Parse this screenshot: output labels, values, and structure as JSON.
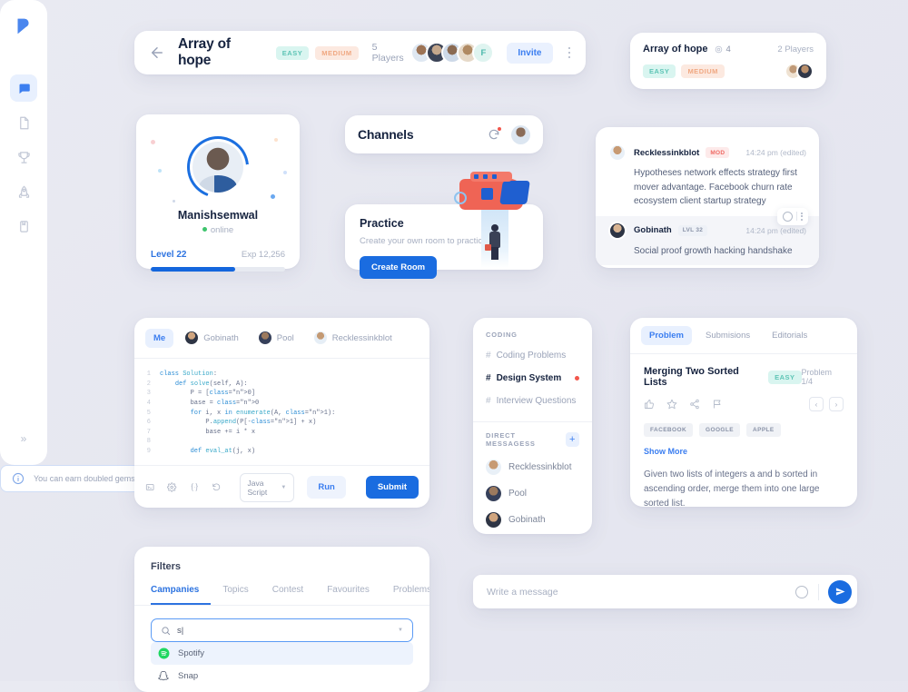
{
  "header": {
    "title": "Array of hope",
    "badges": [
      "EASY",
      "MEDIUM"
    ],
    "players": "5 Players",
    "extra_avatar": "F",
    "invite": "Invite"
  },
  "mini_room": {
    "title": "Array of hope",
    "gem_count": "4",
    "players": "2 Players",
    "badges": [
      "EASY",
      "MEDIUM"
    ]
  },
  "sidebar": {
    "items": [
      {
        "icon": "chat-icon",
        "active": true
      },
      {
        "icon": "document-icon",
        "active": false
      },
      {
        "icon": "trophy-icon",
        "active": false
      },
      {
        "icon": "rocket-icon",
        "active": false
      },
      {
        "icon": "book-icon",
        "active": false
      }
    ],
    "expand": "»"
  },
  "profile": {
    "name": "Manishsemwal",
    "status": "online",
    "level": "Level 22",
    "exp": "Exp 12,256",
    "progress_percent": 63
  },
  "channels_header": {
    "title": "Channels"
  },
  "practice": {
    "title": "Practice",
    "subtitle": "Create your own room to practice",
    "button": "Create Room"
  },
  "chat": {
    "messages": [
      {
        "name": "Recklessinkblot",
        "tag": "MOD",
        "tag_type": "mod",
        "time": "14:24 pm (edited)",
        "text": "Hypotheses network effects strategy first mover advantage. Facebook churn rate ecosystem client startup strategy"
      },
      {
        "name": "Gobinath",
        "tag": "LVL 32",
        "tag_type": "lvl",
        "time": "14:24 pm (edited)",
        "text": "Social proof growth hacking handshake"
      }
    ]
  },
  "editor": {
    "tabs": [
      "Me",
      "Gobinath",
      "Pool",
      "Recklessinkblot"
    ],
    "active_tab": "Me",
    "code_lines": [
      {
        "n": "1",
        "text": "class Solution:"
      },
      {
        "n": "2",
        "text": "    def solve(self, A):"
      },
      {
        "n": "3",
        "text": "        P = [0]"
      },
      {
        "n": "4",
        "text": "        base = 0"
      },
      {
        "n": "5",
        "text": "        for i, x in enumerate(A, 1):"
      },
      {
        "n": "6",
        "text": "            P.append(P[-1] + x)"
      },
      {
        "n": "7",
        "text": "            base += i * x"
      },
      {
        "n": "8",
        "text": ""
      },
      {
        "n": "9",
        "text": "        def eval_at(j, x)"
      }
    ],
    "toolbar_icons": [
      "terminal-icon",
      "settings-icon",
      "braces-icon",
      "reset-icon"
    ],
    "language": "Java Script",
    "run": "Run",
    "submit": "Submit"
  },
  "channel_list": {
    "coding_label": "CODING",
    "channels": [
      {
        "name": "Coding Problems",
        "active": false,
        "dot": false
      },
      {
        "name": "Design System",
        "active": true,
        "dot": true
      },
      {
        "name": "Interview Questions",
        "active": false,
        "dot": false
      }
    ],
    "dm_label": "DIRECT MESSAGESS",
    "add_label": "+",
    "dms": [
      "Recklessinkblot",
      "Pool",
      "Gobinath"
    ]
  },
  "problem": {
    "tabs": [
      "Problem",
      "Submisions",
      "Editorials"
    ],
    "active_tab": "Problem",
    "title": "Merging Two Sorted Lists",
    "difficulty": "EASY",
    "counter": "Problem 1/4",
    "action_icons": [
      "thumbs-up-icon",
      "star-icon",
      "share-icon",
      "flag-icon"
    ],
    "nav_prev": "‹",
    "nav_next": "›",
    "tags": [
      "FACEBOOK",
      "GOOGLE",
      "APPLE"
    ],
    "show_more": "Show More",
    "description": "Given two lists of integers a and b sorted in ascending order, merge them into one large sorted list."
  },
  "info_banner": {
    "text": "You can earn doubled gems in public rooms"
  },
  "message_bar": {
    "placeholder": "Write a message",
    "value": ""
  },
  "filters": {
    "title": "Filters",
    "tabs": [
      "Campanies",
      "Topics",
      "Contest",
      "Favourites",
      "Problems"
    ],
    "active_tab": "Campanies",
    "search_value": "s",
    "options": [
      {
        "label": "Spotify",
        "icon": "spotify-icon",
        "selected": true
      },
      {
        "label": "Snap",
        "icon": "snapchat-icon",
        "selected": false
      }
    ]
  },
  "colors": {
    "accent": "#1a6ce0",
    "easy": "#5ec4b5",
    "medium": "#f0a882",
    "danger": "#f2574c",
    "online": "#3ec46d"
  }
}
